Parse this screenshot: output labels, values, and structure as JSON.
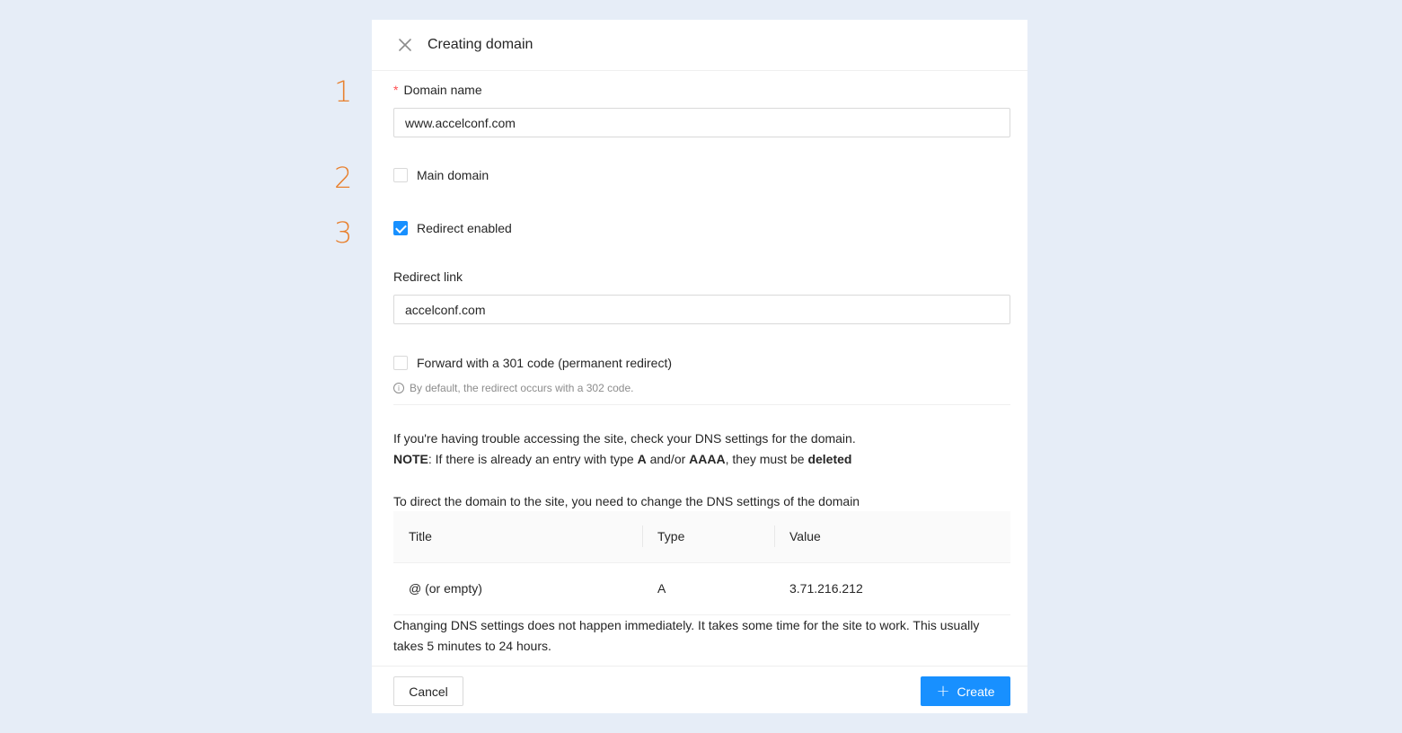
{
  "steps": [
    "1",
    "2",
    "3"
  ],
  "drawer": {
    "title": "Creating domain",
    "close_icon": "close-icon"
  },
  "form": {
    "domain_name": {
      "required_mark": "*",
      "label": "Domain name",
      "value": "www.accelconf.com"
    },
    "main_domain": {
      "label": "Main domain",
      "checked": false
    },
    "redirect_enabled": {
      "label": "Redirect enabled",
      "checked": true
    },
    "redirect_link": {
      "label": "Redirect link",
      "value": "accelconf.com"
    },
    "forward_301": {
      "label": "Forward with a 301 code (permanent redirect)",
      "checked": false,
      "hint": "By default, the redirect occurs with a 302 code."
    }
  },
  "dns_info": {
    "line1": "If you're having trouble accessing the site, check your DNS settings for the domain.",
    "note_bold": "NOTE",
    "note_text1": ": If there is already an entry with type ",
    "note_type_a": "A",
    "note_text2": " and/or ",
    "note_type_aaaa": "AAAA",
    "note_text3": ", they must be ",
    "note_deleted": "deleted",
    "direct_text": "To direct the domain to the site, you need to change the DNS settings of the domain",
    "table": {
      "headers": [
        "Title",
        "Type",
        "Value"
      ],
      "rows": [
        [
          "@ (or empty)",
          "A",
          "3.71.216.212"
        ]
      ]
    },
    "footnote": "Changing DNS settings does not happen immediately. It takes some time for the site to work. This usually takes 5 minutes to 24 hours."
  },
  "footer": {
    "cancel_label": "Cancel",
    "create_label": "Create",
    "create_icon": "plus-icon"
  },
  "colors": {
    "accent": "#1890ff",
    "step_number": "#e8812f",
    "background": "#e6edf7"
  }
}
